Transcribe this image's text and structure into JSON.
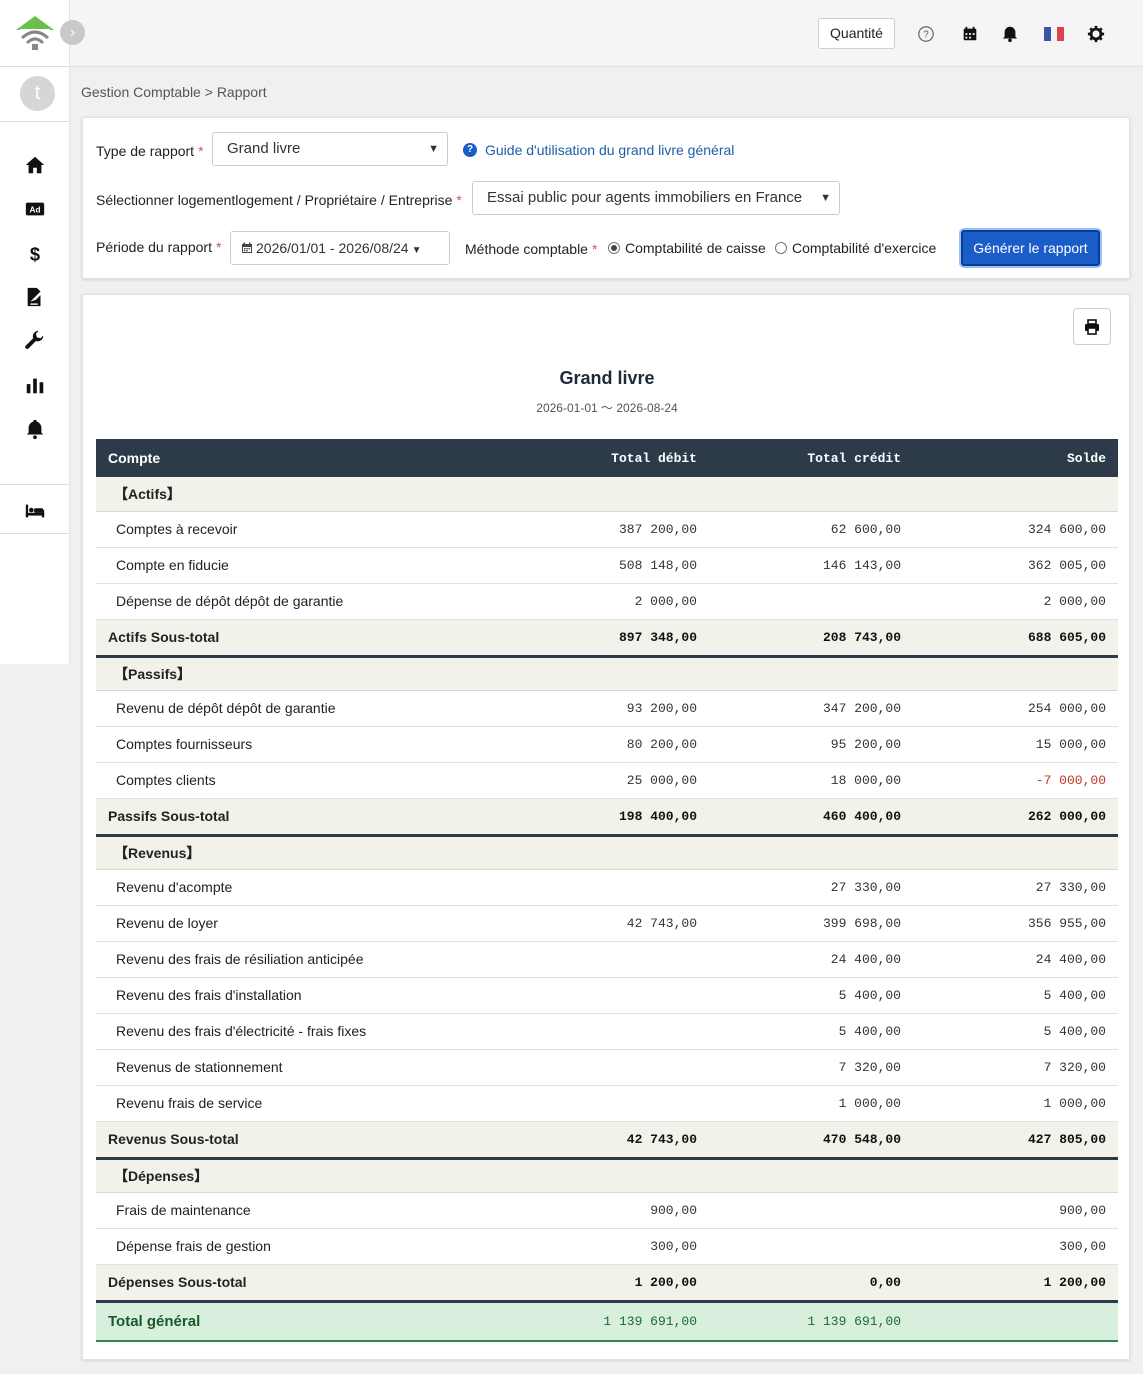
{
  "sidebar": {
    "avatar_letter": "t",
    "nav": [
      {
        "icon": "home-icon"
      },
      {
        "icon": "ad-icon"
      },
      {
        "icon": "dollar-icon"
      },
      {
        "icon": "contract-icon"
      },
      {
        "icon": "wrench-icon"
      },
      {
        "icon": "bar-chart-icon"
      },
      {
        "icon": "bell-icon"
      },
      {
        "icon": "bed-icon"
      }
    ]
  },
  "topbar": {
    "quantity_label": "Quantité"
  },
  "breadcrumb": {
    "parent": "Gestion Comptable",
    "separator": ">",
    "current": "Rapport"
  },
  "form": {
    "report_type_label": "Type de rapport",
    "report_type_value": "Grand livre",
    "guide_link": "Guide d'utilisation du grand livre général",
    "property_label": "Sélectionner logementlogement / Propriétaire / Entreprise",
    "property_value": "Essai public pour agents immobiliers en France",
    "period_label": "Période du rapport",
    "period_value": "2026/01/01 - 2026/08/24",
    "method_label": "Méthode comptable",
    "method_options": [
      "Comptabilité de caisse",
      "Comptabilité d'exercice"
    ],
    "method_selected": "Comptabilité de caisse",
    "required_mark": "*",
    "generate_button": "Générer le rapport"
  },
  "report": {
    "title": "Grand livre",
    "period": "2026-01-01 〜 2026-08-24",
    "columns": [
      "Compte",
      "Total débit",
      "Total crédit",
      "Solde"
    ],
    "sections": [
      {
        "name": "【Actifs】",
        "rows": [
          {
            "account": "Comptes à recevoir",
            "debit": "387 200,00",
            "credit": "62 600,00",
            "balance": "324 600,00"
          },
          {
            "account": "Compte en fiducie",
            "debit": "508 148,00",
            "credit": "146 143,00",
            "balance": "362 005,00"
          },
          {
            "account": "Dépense de dépôt dépôt de garantie",
            "debit": "2 000,00",
            "credit": "",
            "balance": "2 000,00"
          }
        ],
        "subtotal": {
          "label": "Actifs Sous-total",
          "debit": "897 348,00",
          "credit": "208 743,00",
          "balance": "688 605,00"
        }
      },
      {
        "name": "【Passifs】",
        "rows": [
          {
            "account": "Revenu de dépôt dépôt de garantie",
            "debit": "93 200,00",
            "credit": "347 200,00",
            "balance": "254 000,00"
          },
          {
            "account": "Comptes fournisseurs",
            "debit": "80 200,00",
            "credit": "95 200,00",
            "balance": "15 000,00"
          },
          {
            "account": "Comptes clients",
            "debit": "25 000,00",
            "credit": "18 000,00",
            "balance": "-7 000,00"
          }
        ],
        "subtotal": {
          "label": "Passifs Sous-total",
          "debit": "198 400,00",
          "credit": "460 400,00",
          "balance": "262 000,00"
        }
      },
      {
        "name": "【Revenus】",
        "rows": [
          {
            "account": "Revenu d'acompte",
            "debit": "",
            "credit": "27 330,00",
            "balance": "27 330,00"
          },
          {
            "account": "Revenu de loyer",
            "debit": "42 743,00",
            "credit": "399 698,00",
            "balance": "356 955,00"
          },
          {
            "account": "Revenu des frais de résiliation anticipée",
            "debit": "",
            "credit": "24 400,00",
            "balance": "24 400,00"
          },
          {
            "account": "Revenu des frais d'installation",
            "debit": "",
            "credit": "5 400,00",
            "balance": "5 400,00"
          },
          {
            "account": "Revenu des frais d'électricité - frais fixes",
            "debit": "",
            "credit": "5 400,00",
            "balance": "5 400,00"
          },
          {
            "account": "Revenus de stationnement",
            "debit": "",
            "credit": "7 320,00",
            "balance": "7 320,00"
          },
          {
            "account": "Revenu frais de service",
            "debit": "",
            "credit": "1 000,00",
            "balance": "1 000,00"
          }
        ],
        "subtotal": {
          "label": "Revenus Sous-total",
          "debit": "42 743,00",
          "credit": "470 548,00",
          "balance": "427 805,00"
        }
      },
      {
        "name": "【Dépenses】",
        "rows": [
          {
            "account": "Frais de maintenance",
            "debit": "900,00",
            "credit": "",
            "balance": "900,00"
          },
          {
            "account": "Dépense frais de gestion",
            "debit": "300,00",
            "credit": "",
            "balance": "300,00"
          }
        ],
        "subtotal": {
          "label": "Dépenses Sous-total",
          "debit": "1 200,00",
          "credit": "0,00",
          "balance": "1 200,00"
        }
      }
    ],
    "grand_total": {
      "label": "Total général",
      "debit": "1 139 691,00",
      "credit": "1 139 691,00",
      "balance": ""
    }
  }
}
